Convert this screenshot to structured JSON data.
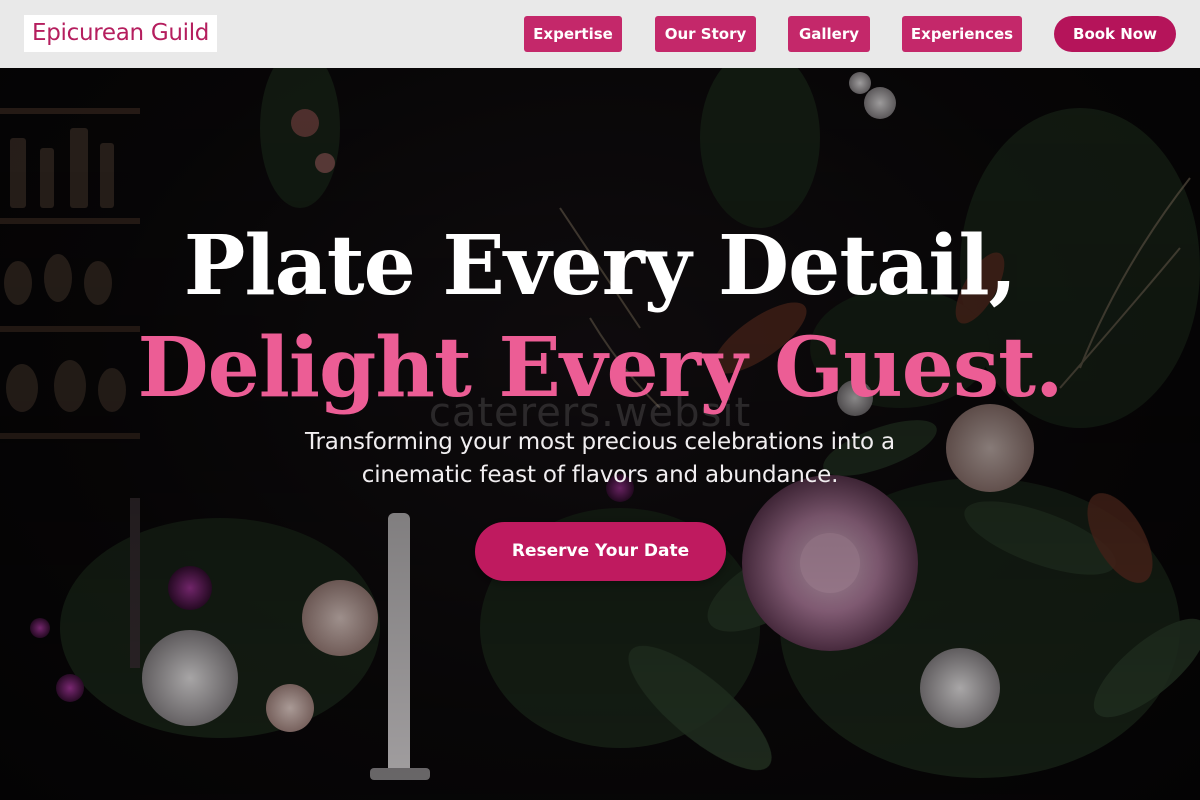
{
  "brand": {
    "logo_text": "Epicurean Guild"
  },
  "nav": {
    "items": [
      {
        "label": "Expertise"
      },
      {
        "label": "Our Story"
      },
      {
        "label": "Gallery"
      },
      {
        "label": "Experiences"
      }
    ],
    "book_label": "Book Now"
  },
  "hero": {
    "headline_line1": "Plate Every Detail,",
    "headline_line2": "Delight Every Guest.",
    "watermark": "caterers.websit",
    "subtext": "Transforming your most precious celebrations into a cinematic feast of flavors and abundance.",
    "cta_label": "Reserve Your Date"
  },
  "colors": {
    "brand_pink": "#b51e5e",
    "nav_button": "#c4286a",
    "accent_headline": "#ec5d95",
    "cta": "#bf1a5f",
    "topbar": "#e9e9e9"
  }
}
